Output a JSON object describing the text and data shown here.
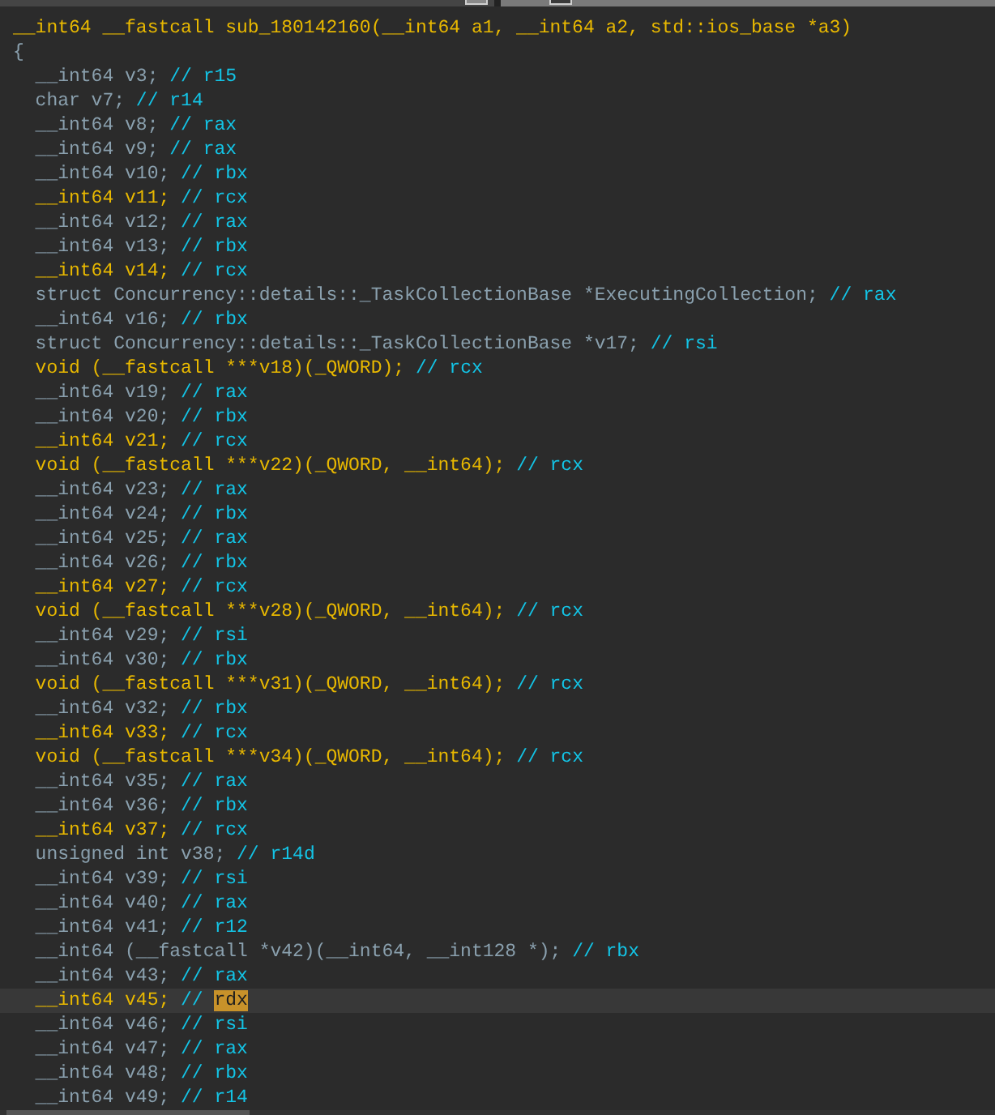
{
  "tabs": [
    {
      "selected": false
    },
    {
      "selected": true
    }
  ],
  "lines": [
    {
      "code": "__int64 __fastcall sub_180142160(__int64 a1, __int64 a2, std::ios_base *a3)",
      "highlighted": true,
      "current": false
    },
    {
      "code": "{",
      "highlighted": false,
      "current": false
    },
    {
      "code": "  __int64 v3;",
      "register": "r15",
      "highlighted": false,
      "current": false,
      "marked": false
    },
    {
      "code": "  char v7;",
      "register": "r14",
      "highlighted": false,
      "current": false,
      "marked": false
    },
    {
      "code": "  __int64 v8;",
      "register": "rax",
      "highlighted": false,
      "current": false,
      "marked": false
    },
    {
      "code": "  __int64 v9;",
      "register": "rax",
      "highlighted": false,
      "current": false,
      "marked": false
    },
    {
      "code": "  __int64 v10;",
      "register": "rbx",
      "highlighted": false,
      "current": false,
      "marked": false
    },
    {
      "code": "  __int64 v11;",
      "register": "rcx",
      "highlighted": true,
      "current": false,
      "marked": false
    },
    {
      "code": "  __int64 v12;",
      "register": "rax",
      "highlighted": false,
      "current": false,
      "marked": false
    },
    {
      "code": "  __int64 v13;",
      "register": "rbx",
      "highlighted": false,
      "current": false,
      "marked": false
    },
    {
      "code": "  __int64 v14;",
      "register": "rcx",
      "highlighted": true,
      "current": false,
      "marked": false
    },
    {
      "code": "  struct Concurrency::details::_TaskCollectionBase *ExecutingCollection;",
      "register": "rax",
      "highlighted": false,
      "current": false,
      "marked": false
    },
    {
      "code": "  __int64 v16;",
      "register": "rbx",
      "highlighted": false,
      "current": false,
      "marked": false
    },
    {
      "code": "  struct Concurrency::details::_TaskCollectionBase *v17;",
      "register": "rsi",
      "highlighted": false,
      "current": false,
      "marked": false
    },
    {
      "code": "  void (__fastcall ***v18)(_QWORD);",
      "register": "rcx",
      "highlighted": true,
      "current": false,
      "marked": false
    },
    {
      "code": "  __int64 v19;",
      "register": "rax",
      "highlighted": false,
      "current": false,
      "marked": false
    },
    {
      "code": "  __int64 v20;",
      "register": "rbx",
      "highlighted": false,
      "current": false,
      "marked": false
    },
    {
      "code": "  __int64 v21;",
      "register": "rcx",
      "highlighted": true,
      "current": false,
      "marked": false
    },
    {
      "code": "  void (__fastcall ***v22)(_QWORD, __int64);",
      "register": "rcx",
      "highlighted": true,
      "current": false,
      "marked": false
    },
    {
      "code": "  __int64 v23;",
      "register": "rax",
      "highlighted": false,
      "current": false,
      "marked": false
    },
    {
      "code": "  __int64 v24;",
      "register": "rbx",
      "highlighted": false,
      "current": false,
      "marked": false
    },
    {
      "code": "  __int64 v25;",
      "register": "rax",
      "highlighted": false,
      "current": false,
      "marked": false
    },
    {
      "code": "  __int64 v26;",
      "register": "rbx",
      "highlighted": false,
      "current": false,
      "marked": false
    },
    {
      "code": "  __int64 v27;",
      "register": "rcx",
      "highlighted": true,
      "current": false,
      "marked": false
    },
    {
      "code": "  void (__fastcall ***v28)(_QWORD, __int64);",
      "register": "rcx",
      "highlighted": true,
      "current": false,
      "marked": false
    },
    {
      "code": "  __int64 v29;",
      "register": "rsi",
      "highlighted": false,
      "current": false,
      "marked": false
    },
    {
      "code": "  __int64 v30;",
      "register": "rbx",
      "highlighted": false,
      "current": false,
      "marked": false
    },
    {
      "code": "  void (__fastcall ***v31)(_QWORD, __int64);",
      "register": "rcx",
      "highlighted": true,
      "current": false,
      "marked": false
    },
    {
      "code": "  __int64 v32;",
      "register": "rbx",
      "highlighted": false,
      "current": false,
      "marked": false
    },
    {
      "code": "  __int64 v33;",
      "register": "rcx",
      "highlighted": true,
      "current": false,
      "marked": false
    },
    {
      "code": "  void (__fastcall ***v34)(_QWORD, __int64);",
      "register": "rcx",
      "highlighted": true,
      "current": false,
      "marked": false
    },
    {
      "code": "  __int64 v35;",
      "register": "rax",
      "highlighted": false,
      "current": false,
      "marked": false
    },
    {
      "code": "  __int64 v36;",
      "register": "rbx",
      "highlighted": false,
      "current": false,
      "marked": false
    },
    {
      "code": "  __int64 v37;",
      "register": "rcx",
      "highlighted": true,
      "current": false,
      "marked": false
    },
    {
      "code": "  unsigned int v38;",
      "register": "r14d",
      "highlighted": false,
      "current": false,
      "marked": false
    },
    {
      "code": "  __int64 v39;",
      "register": "rsi",
      "highlighted": false,
      "current": false,
      "marked": false
    },
    {
      "code": "  __int64 v40;",
      "register": "rax",
      "highlighted": false,
      "current": false,
      "marked": false
    },
    {
      "code": "  __int64 v41;",
      "register": "r12",
      "highlighted": false,
      "current": false,
      "marked": false
    },
    {
      "code": "  __int64 (__fastcall *v42)(__int64, __int128 *);",
      "register": "rbx",
      "highlighted": false,
      "current": false,
      "marked": false
    },
    {
      "code": "  __int64 v43;",
      "register": "rax",
      "highlighted": false,
      "current": false,
      "marked": false
    },
    {
      "code": "  __int64 v45;",
      "register": "rdx",
      "highlighted": true,
      "current": true,
      "marked": true
    },
    {
      "code": "  __int64 v46;",
      "register": "rsi",
      "highlighted": false,
      "current": false,
      "marked": false
    },
    {
      "code": "  __int64 v47;",
      "register": "rax",
      "highlighted": false,
      "current": false,
      "marked": false
    },
    {
      "code": "  __int64 v48;",
      "register": "rbx",
      "highlighted": false,
      "current": false,
      "marked": false
    },
    {
      "code": "  __int64 v49;",
      "register": "r14",
      "highlighted": false,
      "current": false,
      "marked": false
    }
  ],
  "comment_marker": "//"
}
